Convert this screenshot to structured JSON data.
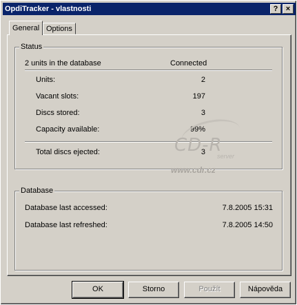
{
  "window": {
    "title": "OpdiTracker - vlastnosti",
    "help_button": "?",
    "close_button": "×"
  },
  "tabs": [
    {
      "label": "General",
      "active": true
    },
    {
      "label": "Options",
      "active": false
    }
  ],
  "status": {
    "title": "Status",
    "summary_label": "2 units in the database",
    "summary_value": "Connected",
    "rows": [
      {
        "label": "Units:",
        "value": "2"
      },
      {
        "label": "Vacant slots:",
        "value": "197"
      },
      {
        "label": "Discs stored:",
        "value": "3"
      },
      {
        "label": "Capacity available:",
        "value": "99%"
      }
    ],
    "total_label": "Total discs ejected:",
    "total_value": "3"
  },
  "database": {
    "title": "Database",
    "rows": [
      {
        "label": "Database last accessed:",
        "value": "7.8.2005 15:31"
      },
      {
        "label": "Database last refreshed:",
        "value": "7.8.2005 14:50"
      }
    ]
  },
  "watermark": {
    "logo": "CD-R",
    "tagline": "server",
    "url": "www.cdr.cz"
  },
  "buttons": {
    "ok": "OK",
    "cancel": "Storno",
    "apply": "Použít",
    "help": "Nápověda"
  },
  "colors": {
    "title_bar": "#0a246a",
    "face": "#d4d0c8"
  }
}
